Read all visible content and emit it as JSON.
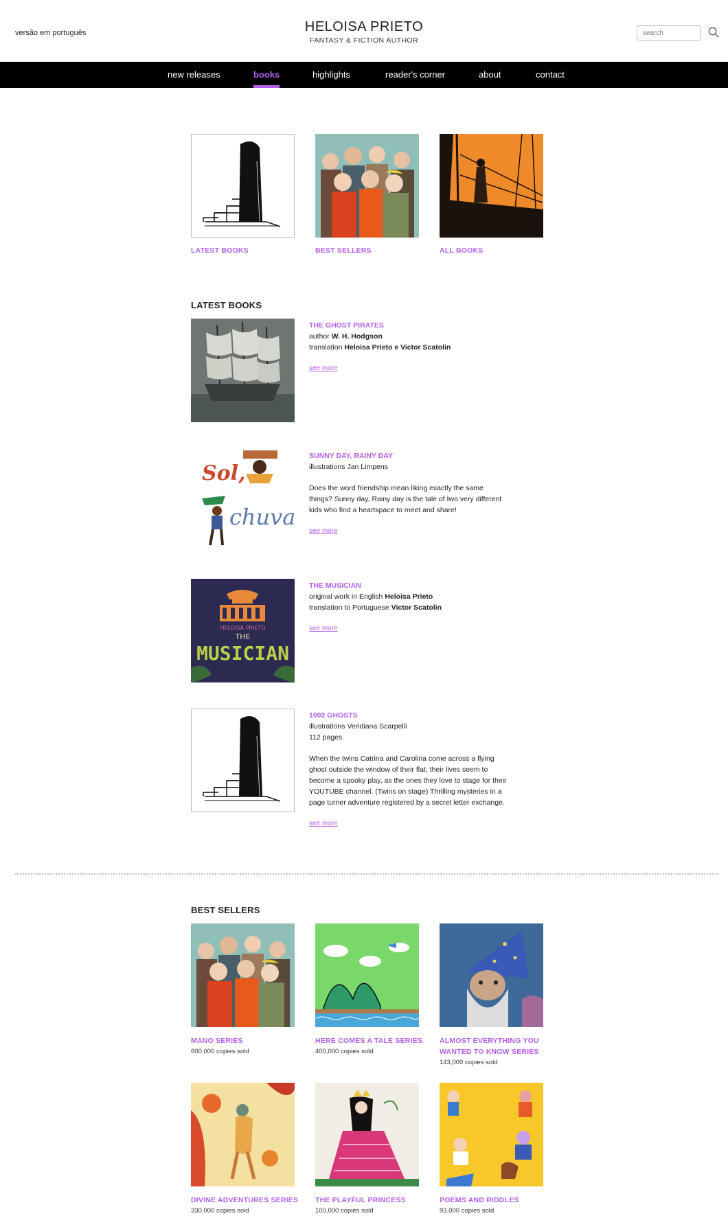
{
  "header": {
    "lang_link": "versão em português",
    "brand_name": "HELOISA PRIETO",
    "brand_sub": "FANTASY & FICTION AUTHOR",
    "search_placeholder": "search"
  },
  "nav": {
    "items": [
      {
        "label": "new releases"
      },
      {
        "label": "books",
        "active": true
      },
      {
        "label": "highlights"
      },
      {
        "label": "reader's corner"
      },
      {
        "label": "about"
      },
      {
        "label": "contact"
      }
    ]
  },
  "categories": [
    {
      "label": "LATEST BOOKS",
      "image": "ghost-stairs-illustration"
    },
    {
      "label": "BEST SELLERS",
      "image": "crowd-illustration"
    },
    {
      "label": "ALL BOOKS",
      "image": "ship-orange-illustration"
    }
  ],
  "latest": {
    "title": "LATEST BOOKS",
    "books": [
      {
        "title": "THE GHOST PIRATES",
        "author_prefix": "author ",
        "author": "W. H. Hodgson",
        "translation_prefix": "translation ",
        "translation": "Heloisa Prieto e Victor Scatolin",
        "see_more": "see more"
      },
      {
        "title": "SUNNY DAY, RAINY DAY",
        "illustrations": "illustrations Jan Limpens",
        "description": "Does the word friendship mean liking exactly the same things? Sunny day, Rainy day is the tale of two very different kids who find a heartspace to meet and share!",
        "cover_text_1": "Sol,",
        "cover_text_2": "chuva",
        "see_more": "see more"
      },
      {
        "title": "THE MUSICIAN",
        "original_prefix": "original work in English ",
        "original": "Heloisa Prieto",
        "translation_prefix": "translation to Portuguese ",
        "translation": "Victor Scatolin",
        "cover_author": "HELOISA PRIETO",
        "cover_the": "THE",
        "cover_title": "MUSICIAN",
        "see_more": "see more"
      },
      {
        "title": "1002 GHOSTS",
        "illustrations": "illustrations Veridiana Scarpelli",
        "pages": "112 pages",
        "description": "When the twins Catrina and Carolina come across a flying ghost outside the window of their flat, their lives seem to become a spooky play, as the ones they love to stage for their YOUTUBE channel. (Twins on stage) Thrilling mysteries in a page turner adventure registered by a secret letter exchange.",
        "see_more": "see more"
      }
    ]
  },
  "best_sellers": {
    "title": "BEST SELLERS",
    "items": [
      {
        "title": "MANO SERIES",
        "copies": "600,000 copies sold"
      },
      {
        "title": "HERE COMES A TALE SERIES",
        "copies": "400,000 copies sold"
      },
      {
        "title": "ALMOST EVERYTHING YOU WANTED TO KNOW SERIES",
        "copies": "143,000 copies sold"
      },
      {
        "title": "DIVINE ADVENTURES SERIES",
        "copies": "330,000 copies sold"
      },
      {
        "title": "THE PLAYFUL PRINCESS",
        "copies": "100,000 copies sold"
      },
      {
        "title": "POEMS AND RIDDLES",
        "copies": "93,000 copies sold"
      }
    ]
  },
  "colors": {
    "accent": "#b35ee8",
    "nav_bg": "#000000"
  }
}
